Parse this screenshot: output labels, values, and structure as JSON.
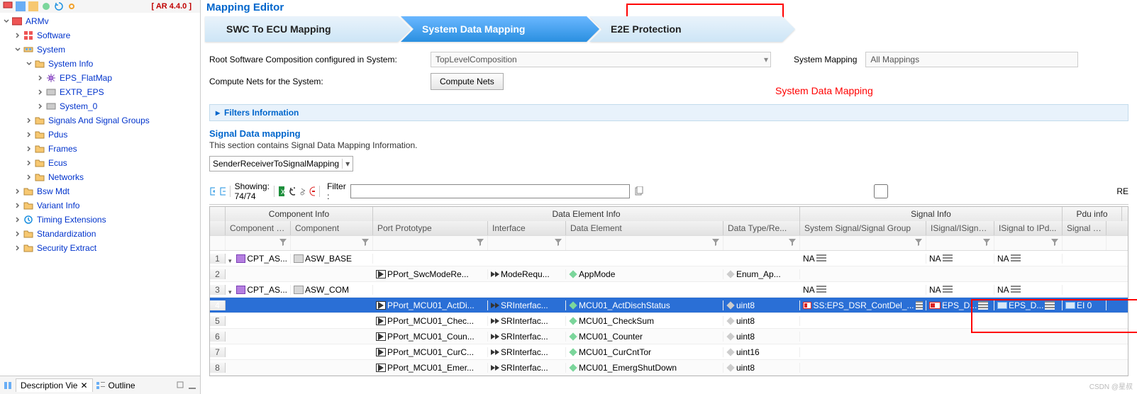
{
  "sidebar": {
    "ar_version": "[ AR 4.4.0 ]",
    "root_label": "ARMv",
    "items": [
      {
        "label": "Software",
        "indent": 18,
        "icon": "grid",
        "exp": "closed"
      },
      {
        "label": "System",
        "indent": 18,
        "icon": "bus",
        "exp": "open"
      },
      {
        "label": "System Info",
        "indent": 34,
        "icon": "folder",
        "exp": "open"
      },
      {
        "label": "EPS_FlatMap",
        "indent": 50,
        "icon": "gear",
        "exp": "closed"
      },
      {
        "label": "EXTR_EPS",
        "indent": 50,
        "icon": "grey",
        "exp": "closed"
      },
      {
        "label": "System_0",
        "indent": 50,
        "icon": "grey",
        "exp": "closed"
      },
      {
        "label": "Signals And Signal Groups",
        "indent": 34,
        "icon": "folder",
        "exp": "closed"
      },
      {
        "label": "Pdus",
        "indent": 34,
        "icon": "folder",
        "exp": "closed"
      },
      {
        "label": "Frames",
        "indent": 34,
        "icon": "folder",
        "exp": "closed"
      },
      {
        "label": "Ecus",
        "indent": 34,
        "icon": "folder",
        "exp": "closed"
      },
      {
        "label": "Networks",
        "indent": 34,
        "icon": "folder",
        "exp": "closed"
      },
      {
        "label": "Bsw Mdt",
        "indent": 18,
        "icon": "folder",
        "exp": "closed"
      },
      {
        "label": "Variant Info",
        "indent": 18,
        "icon": "folder",
        "exp": "closed"
      },
      {
        "label": "Timing Extensions",
        "indent": 18,
        "icon": "clock",
        "exp": "closed"
      },
      {
        "label": "Standardization",
        "indent": 18,
        "icon": "folder",
        "exp": "closed"
      },
      {
        "label": "Security Extract",
        "indent": 18,
        "icon": "folder",
        "exp": "closed"
      }
    ],
    "bottom": {
      "desc_tab": "Description Vie",
      "outline_tab": "Outline"
    }
  },
  "editor": {
    "title": "Mapping Editor",
    "steps": [
      "SWC To ECU Mapping",
      "System Data Mapping",
      "E2E Protection"
    ],
    "active_step_index": 1,
    "annotation": "System  Data Mapping",
    "root_comp_label": "Root Software Composition configured in System:",
    "root_comp_value": "TopLevelComposition",
    "sys_mapping_label": "System Mapping",
    "sys_mapping_value": "All Mappings",
    "compute_label": "Compute Nets for the System:",
    "compute_btn": "Compute Nets",
    "filters_section": "Filters Information",
    "signal_section": "Signal Data mapping",
    "signal_desc": "This section contains Signal Data Mapping Information.",
    "mapping_select": "SenderReceiverToSignalMapping",
    "showing": "Showing: 74/74",
    "filter_label": "Filter :",
    "re_label": "RE"
  },
  "grid": {
    "groups": [
      "Component Info",
      "Data Element Info",
      "Signal Info",
      "Pdu info"
    ],
    "cols": [
      "Component Pr...",
      "Component",
      "Port Prototype",
      "Interface",
      "Data Element",
      "Data Type/Re...",
      "System Signal/Signal Group",
      "ISignal/ISignal...",
      "ISignal to IPd...",
      "Signal IPd"
    ],
    "rows": [
      {
        "n": "1",
        "comppr": "CPT_AS...",
        "comp": "ASW_BASE",
        "port": "",
        "if": "",
        "de": "",
        "dtype": "",
        "ssg": "NA",
        "isig": "NA",
        "ipdu": "NA",
        "spdu": "",
        "tw": "open",
        "parent": true
      },
      {
        "n": "2",
        "comppr": "",
        "comp": "",
        "port": "PPort_SwcModeRe...",
        "if": "ModeRequ...",
        "de": "AppMode",
        "dtype": "Enum_Ap...",
        "ssg": "",
        "isig": "",
        "ipdu": "",
        "spdu": ""
      },
      {
        "n": "3",
        "comppr": "CPT_AS...",
        "comp": "ASW_COM",
        "port": "",
        "if": "",
        "de": "",
        "dtype": "",
        "ssg": "NA",
        "isig": "NA",
        "ipdu": "NA",
        "spdu": "",
        "tw": "open",
        "parent": true
      },
      {
        "n": "4",
        "comppr": "",
        "comp": "",
        "port": "PPort_MCU01_ActDi...",
        "if": "SRInterfac...",
        "de": "MCU01_ActDischStatus",
        "dtype": "uint8",
        "ssg": "SS:EPS_DSR_ContDel_...",
        "isig": "EPS_D...",
        "ipdu": "EPS_D...",
        "spdu": "EI    0",
        "sel": true
      },
      {
        "n": "5",
        "comppr": "",
        "comp": "",
        "port": "PPort_MCU01_Chec...",
        "if": "SRInterfac...",
        "de": "MCU01_CheckSum",
        "dtype": "uint8",
        "ssg": "",
        "isig": "",
        "ipdu": "",
        "spdu": ""
      },
      {
        "n": "6",
        "comppr": "",
        "comp": "",
        "port": "PPort_MCU01_Coun...",
        "if": "SRInterfac...",
        "de": "MCU01_Counter",
        "dtype": "uint8",
        "ssg": "",
        "isig": "",
        "ipdu": "",
        "spdu": ""
      },
      {
        "n": "7",
        "comppr": "",
        "comp": "",
        "port": "PPort_MCU01_CurC...",
        "if": "SRInterfac...",
        "de": "MCU01_CurCntTor",
        "dtype": "uint16",
        "ssg": "",
        "isig": "",
        "ipdu": "",
        "spdu": ""
      },
      {
        "n": "8",
        "comppr": "",
        "comp": "",
        "port": "PPort_MCU01_Emer...",
        "if": "SRInterfac...",
        "de": "MCU01_EmergShutDown",
        "dtype": "uint8",
        "ssg": "",
        "isig": "",
        "ipdu": "",
        "spdu": ""
      }
    ]
  },
  "watermark": "CSDN @星叔"
}
